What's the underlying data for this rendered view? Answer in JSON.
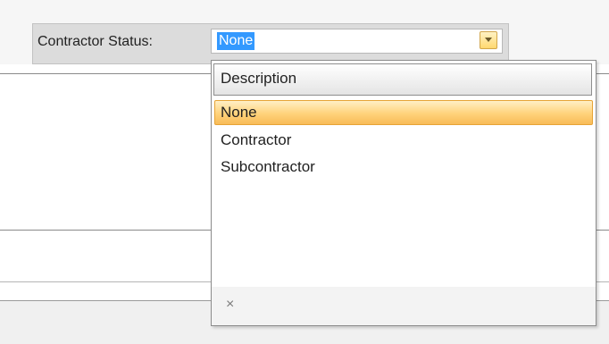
{
  "form": {
    "label": "Contractor Status:",
    "combo": {
      "value": "None",
      "dropdown_icon": "chevron-down-icon"
    }
  },
  "dropdown": {
    "column_header": "Description",
    "items": [
      {
        "label": "None",
        "selected": true
      },
      {
        "label": "Contractor",
        "selected": false
      },
      {
        "label": "Subcontractor",
        "selected": false
      }
    ],
    "footer": {
      "close_glyph": "×",
      "close_icon": "close-icon"
    }
  },
  "colors": {
    "selection_highlight": "#ffd27a",
    "text_selection": "#3399ff",
    "panel_background": "#dcdcdc"
  }
}
